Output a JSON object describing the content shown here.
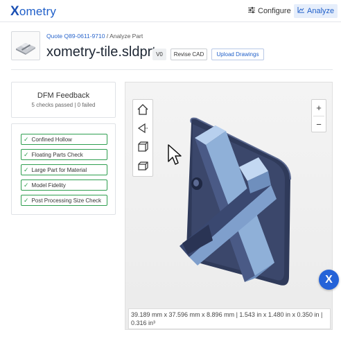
{
  "header": {
    "logo_x": "X",
    "logo_rest": "ometry",
    "configure_label": "Configure",
    "analyze_label": "Analyze"
  },
  "part": {
    "quote_link": "Quote Q89-0611-9710",
    "crumb_separator": " / ",
    "crumb_current": "Analyze Part",
    "title": "xometry-tile.sldprt",
    "version": "V0",
    "revise_label": "Revise CAD",
    "upload_label": "Upload Drawings"
  },
  "dfm": {
    "title": "DFM Feedback",
    "summary": "5 checks passed | 0 failed",
    "checks": [
      {
        "label": "Confined Hollow",
        "status": "passed"
      },
      {
        "label": "Floating Parts Check",
        "status": "passed"
      },
      {
        "label": "Large Part for Material",
        "status": "passed"
      },
      {
        "label": "Model Fidelity",
        "status": "passed"
      },
      {
        "label": "Post Processing Size Check",
        "status": "passed"
      }
    ]
  },
  "viewer": {
    "view_buttons": [
      "home-view-icon",
      "perspective-view-icon",
      "cube-view-icon",
      "box-view-icon"
    ],
    "zoom_in": "+",
    "zoom_out": "−",
    "dimensions": "39.189 mm x 37.596 mm x 8.896 mm | 1.543 in x 1.480 in x 0.350 in | 0.316 in³"
  },
  "assistant": {
    "label": "X"
  },
  "colors": {
    "brand": "#1f5fc9",
    "pass_green": "#2e9e4f",
    "model_dark": "#2f3a5a",
    "model_light": "#8fb0d8"
  }
}
